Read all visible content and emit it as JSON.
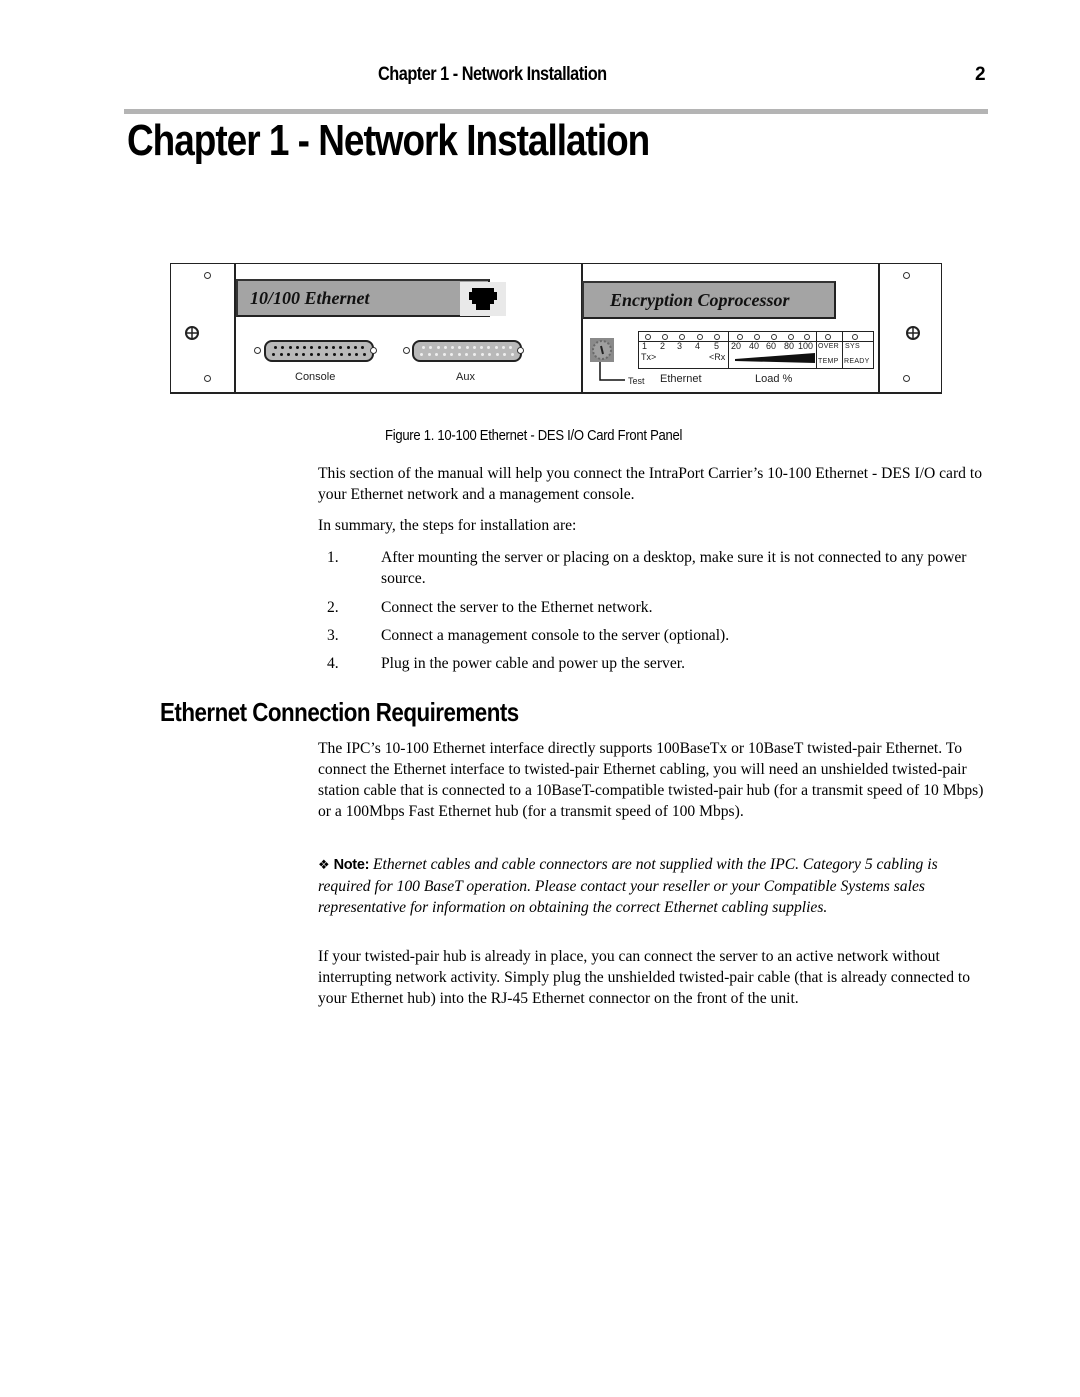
{
  "header": {
    "running_title": "Chapter 1 - Network Installation",
    "page_number": "2"
  },
  "chapter_title": "Chapter 1 - Network Installation",
  "figure": {
    "ethernet_label": "10/100 Ethernet",
    "encryption_label": "Encryption Coprocessor",
    "console_label": "Console",
    "aux_label": "Aux",
    "test_label": "Test",
    "ethernet_group_label": "Ethernet",
    "load_label": "Load %",
    "ethernet_leds": [
      "1",
      "2",
      "3",
      "4",
      "5"
    ],
    "tx_label": "Tx>",
    "rx_label": "<Rx",
    "load_leds": [
      "20",
      "40",
      "60",
      "80",
      "100"
    ],
    "over_temp": [
      "OVER",
      "TEMP"
    ],
    "sys_ready": [
      "SYS",
      "READY"
    ],
    "caption": "Figure 1. 10-100 Ethernet - DES I/O Card Front Panel"
  },
  "intro": {
    "paragraph": "This section of the manual will help you connect the IntraPort Carrier’s 10-100 Ethernet - DES I/O card to your Ethernet network and a management console.",
    "summary_lead": "In summary, the steps for installation are:",
    "steps": [
      {
        "num": "1.",
        "text": "After mounting the server or placing on a desktop, make sure it is not connected to any power source."
      },
      {
        "num": "2.",
        "text": "Connect the server to the Ethernet network."
      },
      {
        "num": "3.",
        "text": "Connect a management console to the server (optional)."
      },
      {
        "num": "4.",
        "text": "Plug in the power cable and power up the server."
      }
    ]
  },
  "section": {
    "heading": "Ethernet Connection Requirements",
    "paragraph1": "The IPC’s 10-100 Ethernet interface directly supports 100BaseTx or 10BaseT twisted-pair Ethernet. To connect the Ethernet interface to twisted-pair Ethernet cabling, you will need an unshielded twisted-pair station cable that is connected to a 10BaseT-compatible twisted-pair hub (for a transmit speed of 10 Mbps) or a 100Mbps Fast Ethernet hub (for a transmit speed of 100 Mbps).",
    "note_icon": "diamond-bullet-icon",
    "note_label": "Note:",
    "note_text": "Ethernet cables and cable connectors are not supplied with the IPC.  Category 5 cabling is required for 100 BaseT operation. Please contact your reseller or your Compatible Systems sales representative for information on obtaining the correct Ethernet cabling supplies.",
    "paragraph2": "If your twisted-pair hub is already in place, you can connect the server to an active network without interrupting network activity. Simply plug the unshielded twisted-pair cable (that is already connected to your Ethernet hub) into the RJ-45 Ethernet connector on the front of the unit."
  }
}
